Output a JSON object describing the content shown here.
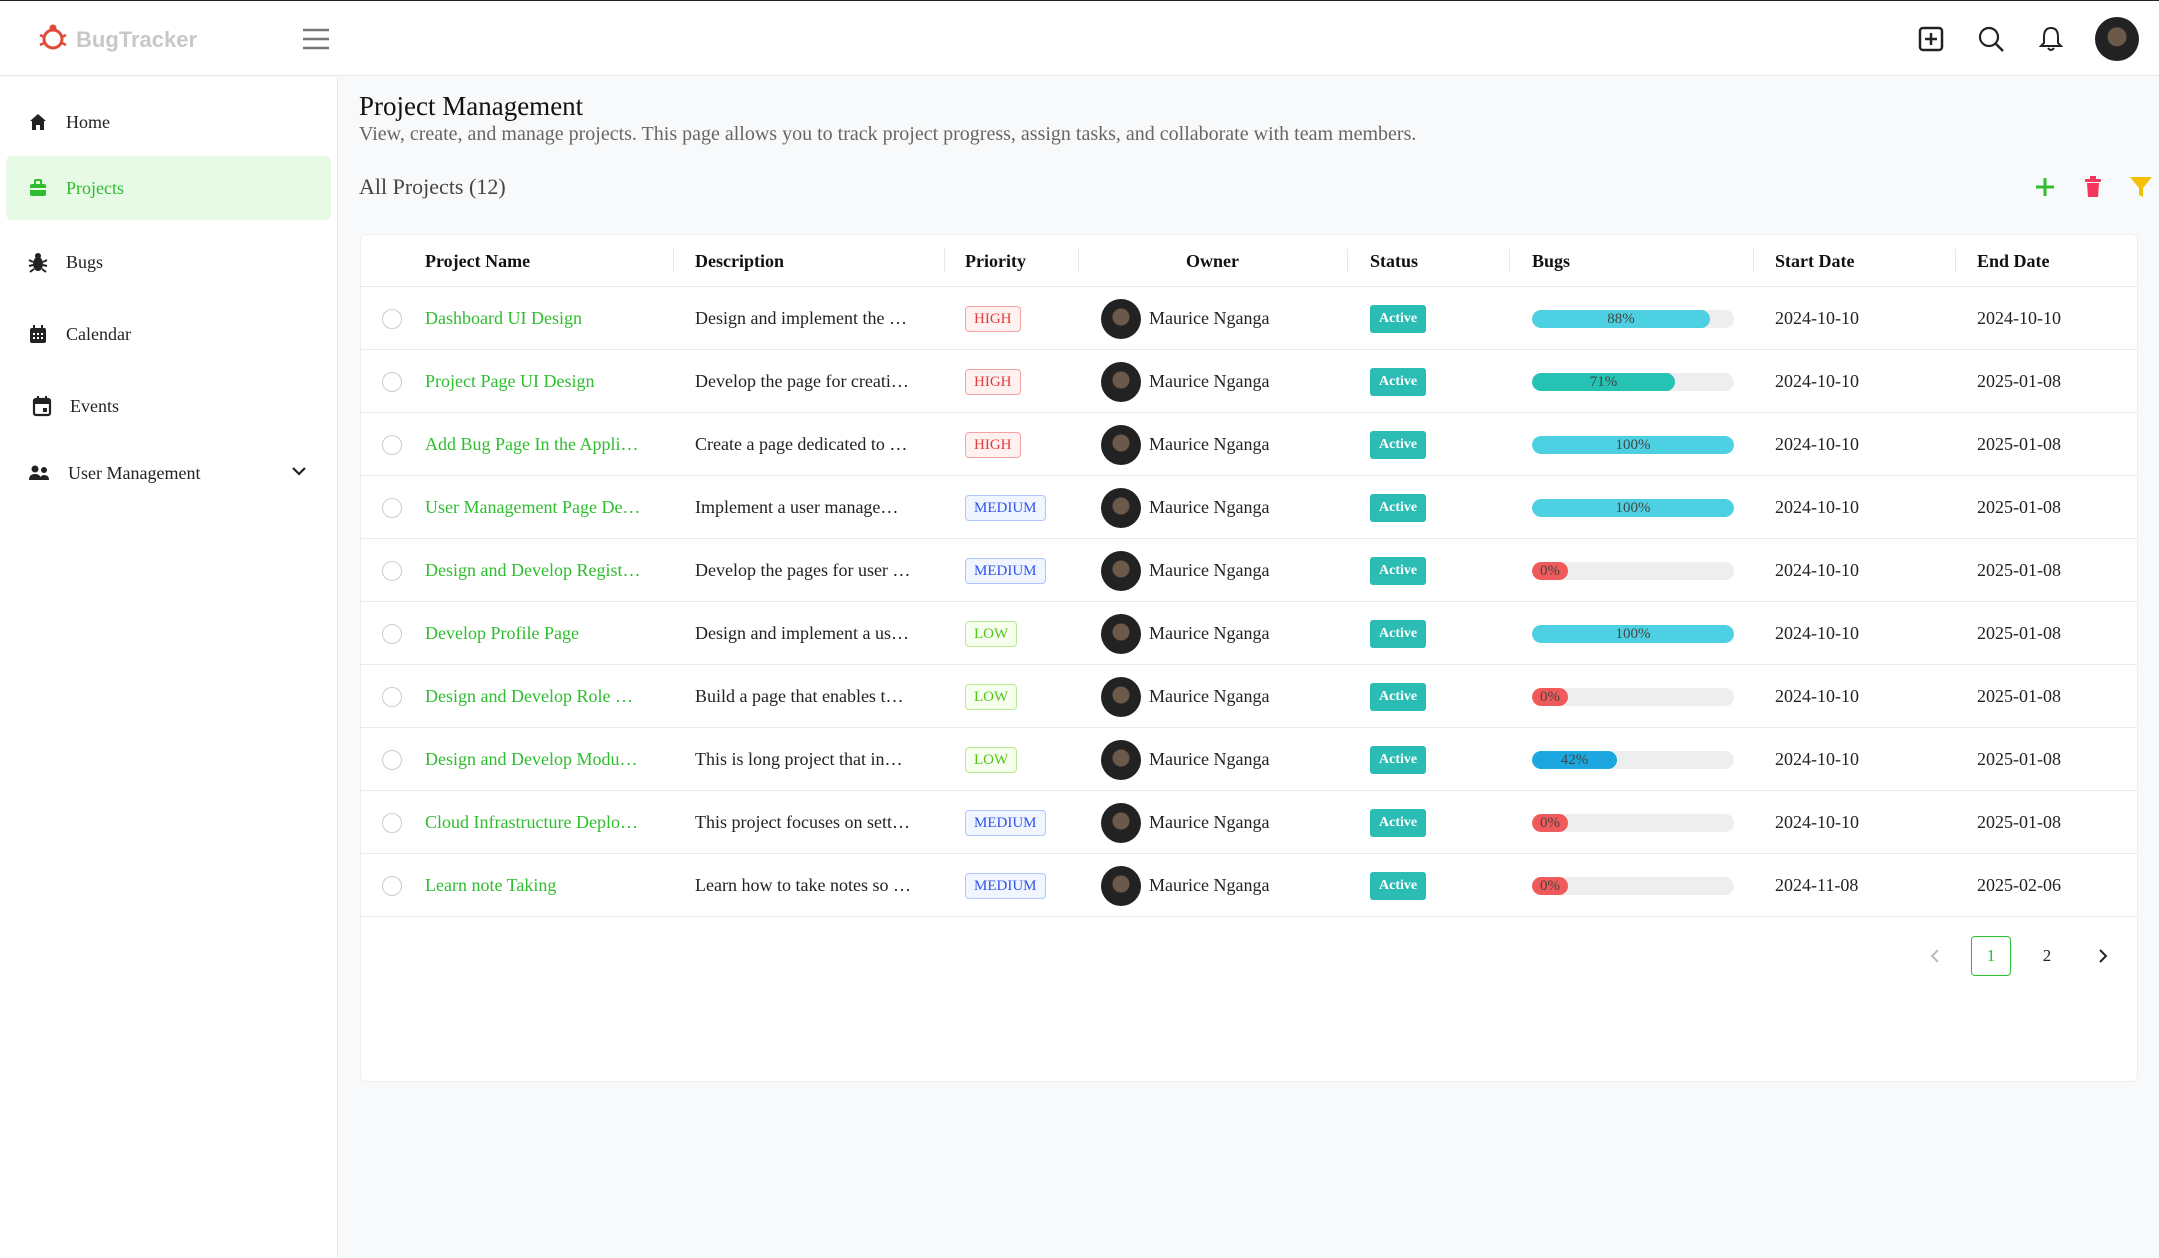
{
  "app": {
    "name": "BugTracker"
  },
  "sidebar": {
    "items": [
      {
        "label": "Home",
        "icon": "home-icon"
      },
      {
        "label": "Projects",
        "icon": "briefcase-icon",
        "active": true
      },
      {
        "label": "Bugs",
        "icon": "bug-icon"
      },
      {
        "label": "Calendar",
        "icon": "calendar-icon"
      },
      {
        "label": "Events",
        "icon": "event-icon"
      },
      {
        "label": "User Management",
        "icon": "users-icon",
        "expandable": true
      }
    ]
  },
  "page": {
    "title": "Project Management",
    "subtitle": "View, create, and manage projects. This page allows you to track project progress, assign tasks, and collaborate with team members.",
    "count_label": "All Projects (12)"
  },
  "table": {
    "columns": [
      "Project Name",
      "Description",
      "Priority",
      "Owner",
      "Status",
      "Bugs",
      "Start Date",
      "End Date"
    ],
    "rows": [
      {
        "name": "Dashboard UI Design",
        "desc": "Design and implement the …",
        "priority": "HIGH",
        "owner": "Maurice Nganga",
        "status": "Active",
        "bugs": 88,
        "bugs_label": "88%",
        "start": "2024-10-10",
        "end": "2024-10-10"
      },
      {
        "name": "Project Page UI Design",
        "desc": "Develop the page for creati…",
        "priority": "HIGH",
        "owner": "Maurice Nganga",
        "status": "Active",
        "bugs": 71,
        "bugs_label": "71%",
        "start": "2024-10-10",
        "end": "2025-01-08"
      },
      {
        "name": "Add Bug Page In the Appli…",
        "desc": "Create a page dedicated to …",
        "priority": "HIGH",
        "owner": "Maurice Nganga",
        "status": "Active",
        "bugs": 100,
        "bugs_label": "100%",
        "start": "2024-10-10",
        "end": "2025-01-08"
      },
      {
        "name": "User Management Page De…",
        "desc": "Implement a user manage…",
        "priority": "MEDIUM",
        "owner": "Maurice Nganga",
        "status": "Active",
        "bugs": 100,
        "bugs_label": "100%",
        "start": "2024-10-10",
        "end": "2025-01-08"
      },
      {
        "name": "Design and Develop Regist…",
        "desc": "Develop the pages for user …",
        "priority": "MEDIUM",
        "owner": "Maurice Nganga",
        "status": "Active",
        "bugs": 0,
        "bugs_label": "0%",
        "start": "2024-10-10",
        "end": "2025-01-08"
      },
      {
        "name": "Develop Profile Page",
        "desc": "Design and implement a us…",
        "priority": "LOW",
        "owner": "Maurice Nganga",
        "status": "Active",
        "bugs": 100,
        "bugs_label": "100%",
        "start": "2024-10-10",
        "end": "2025-01-08"
      },
      {
        "name": "Design and Develop Role …",
        "desc": "Build a page that enables t…",
        "priority": "LOW",
        "owner": "Maurice Nganga",
        "status": "Active",
        "bugs": 0,
        "bugs_label": "0%",
        "start": "2024-10-10",
        "end": "2025-01-08"
      },
      {
        "name": "Design and Develop Modu…",
        "desc": "This is long project that in…",
        "priority": "LOW",
        "owner": "Maurice Nganga",
        "status": "Active",
        "bugs": 42,
        "bugs_label": "42%",
        "start": "2024-10-10",
        "end": "2025-01-08"
      },
      {
        "name": "Cloud Infrastructure Deplo…",
        "desc": "This project focuses on sett…",
        "priority": "MEDIUM",
        "owner": "Maurice Nganga",
        "status": "Active",
        "bugs": 0,
        "bugs_label": "0%",
        "start": "2024-10-10",
        "end": "2025-01-08"
      },
      {
        "name": "Learn note Taking",
        "desc": "Learn how to take notes so …",
        "priority": "MEDIUM",
        "owner": "Maurice Nganga",
        "status": "Active",
        "bugs": 0,
        "bugs_label": "0%",
        "start": "2024-11-08",
        "end": "2025-02-06"
      }
    ]
  },
  "pagination": {
    "pages": [
      "1",
      "2"
    ],
    "current": "1"
  },
  "colors": {
    "accent": "#2ebd2e",
    "bar_full": "#4dd0e1",
    "bar_high": "#26c2b4",
    "bar_mid": "#1ca7e0",
    "bar_zero": "#f05a5a",
    "delete": "#f5365c",
    "filter": "#f5c000"
  }
}
